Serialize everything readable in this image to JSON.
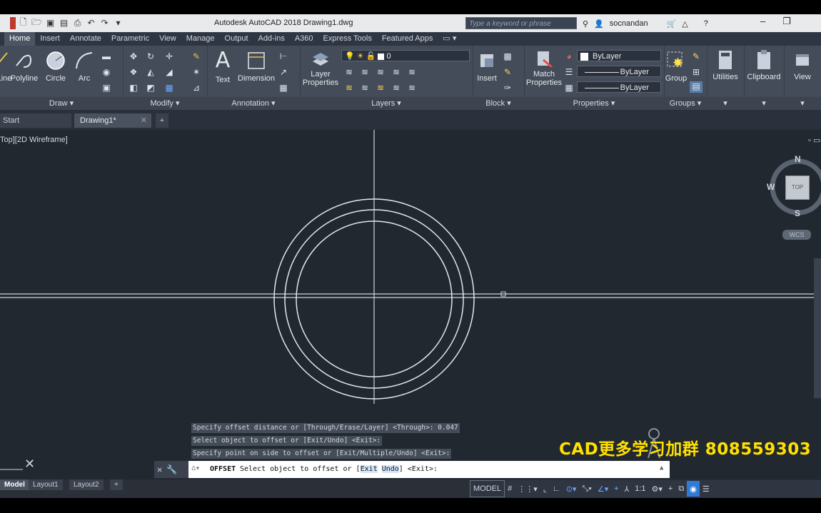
{
  "app": {
    "title": "Autodesk AutoCAD 2018    Drawing1.dwg",
    "search_placeholder": "Type a keyword or phrase",
    "username": "socnandan"
  },
  "ribbon_tabs": [
    "Home",
    "Insert",
    "Annotate",
    "Parametric",
    "View",
    "Manage",
    "Output",
    "Add-ins",
    "A360",
    "Express Tools",
    "Featured Apps"
  ],
  "ribbon": {
    "draw": {
      "label": "Draw ▾",
      "line": "Line",
      "polyline": "Polyline",
      "circle": "Circle",
      "arc": "Arc"
    },
    "modify": {
      "label": "Modify ▾"
    },
    "annotation": {
      "label": "Annotation ▾",
      "text": "Text",
      "dimension": "Dimension"
    },
    "layers": {
      "label": "Layers ▾",
      "layer_properties_1": "Layer",
      "layer_properties_2": "Properties",
      "layer_value": "0"
    },
    "block": {
      "label": "Block ▾",
      "insert": "Insert"
    },
    "properties": {
      "label": "Properties ▾",
      "match_1": "Match",
      "match_2": "Properties",
      "color": "ByLayer",
      "linetype": "ByLayer",
      "lineweight": "ByLayer"
    },
    "groups": {
      "label": "Groups ▾",
      "group": "Group"
    },
    "utilities": {
      "label": "Utilities"
    },
    "clipboard": {
      "label": "Clipboard"
    },
    "view": {
      "label": "View"
    }
  },
  "file_tabs": {
    "start": "Start",
    "drawing": "Drawing1*"
  },
  "viewport": {
    "label": "Top][2D Wireframe]",
    "viewcube": {
      "n": "N",
      "s": "S",
      "w": "W",
      "top": "TOP",
      "wcs": "WCS"
    }
  },
  "command_history": [
    "Specify offset distance or [Through/Erase/Layer] <Through>: 0.047",
    "Select object to offset or [Exit/Undo] <Exit>:",
    "Specify point on side to offset or [Exit/Multiple/Undo] <Exit>:"
  ],
  "command_line": {
    "command": "OFFSET",
    "prompt_before": "Select object to offset or [",
    "opt_exit": "Exit",
    "opt_undo": "Undo",
    "prompt_after": "] <Exit>:"
  },
  "watermark": "CAD更多学习加群  808559303",
  "layout_tabs": [
    "Model",
    "Layout1",
    "Layout2"
  ],
  "status": {
    "model": "MODEL",
    "scale": "1:1"
  },
  "colors": {
    "canvas": "#212830",
    "ribbon": "#444c59",
    "accent": "#2f7bd8",
    "watermark": "#ffe100"
  }
}
